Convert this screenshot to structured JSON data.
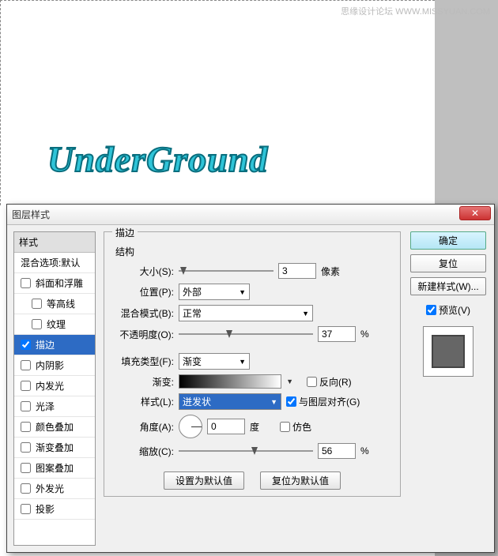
{
  "watermark": "思缘设计论坛  WWW.MISSYUAN.COM",
  "canvas_text": "UnderGround",
  "dialog_title": "图层样式",
  "styles": {
    "header": "样式",
    "blend_default": "混合选项:默认",
    "items": [
      {
        "label": "斜面和浮雕",
        "checked": false
      },
      {
        "label": "等高线",
        "checked": false,
        "indent": true
      },
      {
        "label": "纹理",
        "checked": false,
        "indent": true
      },
      {
        "label": "描边",
        "checked": true,
        "selected": true
      },
      {
        "label": "内阴影",
        "checked": false
      },
      {
        "label": "内发光",
        "checked": false
      },
      {
        "label": "光泽",
        "checked": false
      },
      {
        "label": "颜色叠加",
        "checked": false
      },
      {
        "label": "渐变叠加",
        "checked": false
      },
      {
        "label": "图案叠加",
        "checked": false
      },
      {
        "label": "外发光",
        "checked": false
      },
      {
        "label": "投影",
        "checked": false
      }
    ]
  },
  "stroke": {
    "section_title": "描边",
    "structure_title": "结构",
    "size_label": "大小(S):",
    "size_value": "3",
    "size_unit": "像素",
    "position_label": "位置(P):",
    "position_value": "外部",
    "blend_label": "混合模式(B):",
    "blend_value": "正常",
    "opacity_label": "不透明度(O):",
    "opacity_value": "37",
    "opacity_unit": "%",
    "fill_type_label": "填充类型(F):",
    "fill_type_value": "渐变",
    "gradient_label": "渐变:",
    "reverse_label": "反向(R)",
    "style_label": "样式(L):",
    "style_value": "迸发状",
    "align_label": "与图层对齐(G)",
    "angle_label": "角度(A):",
    "angle_value": "0",
    "angle_unit": "度",
    "dither_label": "仿色",
    "scale_label": "缩放(C):",
    "scale_value": "56",
    "scale_unit": "%",
    "set_default_btn": "设置为默认值",
    "reset_default_btn": "复位为默认值"
  },
  "right": {
    "ok": "确定",
    "reset": "复位",
    "new_style": "新建样式(W)...",
    "preview_label": "预览(V)"
  }
}
